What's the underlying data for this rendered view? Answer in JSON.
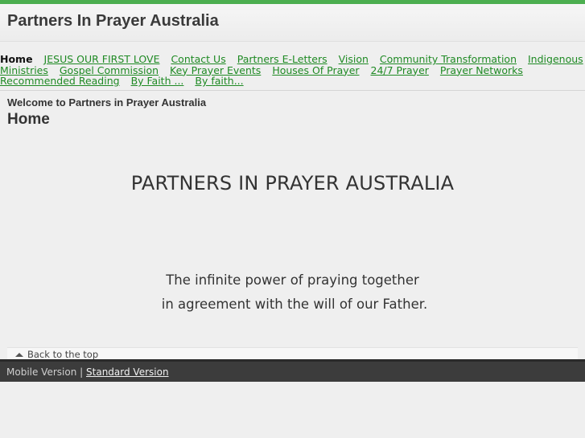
{
  "colors": {
    "accent": "#4caf50",
    "link": "#1f8a24",
    "footer_bg": "#3c3c3c"
  },
  "site": {
    "title": "Partners In Prayer Australia"
  },
  "nav": {
    "items": [
      {
        "label": "Home",
        "current": true
      },
      {
        "label": "JESUS OUR FIRST LOVE"
      },
      {
        "label": "Contact Us"
      },
      {
        "label": "Partners E-Letters"
      },
      {
        "label": "Vision"
      },
      {
        "label": "Community Transformation"
      },
      {
        "label": "Indigenous Ministries"
      },
      {
        "label": "Gospel Commission"
      },
      {
        "label": "Key Prayer Events"
      },
      {
        "label": "Houses Of Prayer"
      },
      {
        "label": "24/7 Prayer"
      },
      {
        "label": "Prayer Networks"
      },
      {
        "label": "Recommended Reading"
      },
      {
        "label": "By Faith ..."
      },
      {
        "label": "By faith..."
      }
    ]
  },
  "main": {
    "welcome": "Welcome to Partners in Prayer Australia",
    "page_title": "Home",
    "hero": "PARTNERS IN PRAYER AUSTRALIA",
    "tagline_line1": "The infinite power of praying together",
    "tagline_line2": "in agreement with the will of our Father.",
    "back_to_top": "Back to the top",
    "back_to_top_icon": "triangle-up-icon"
  },
  "footer": {
    "mobile_label": "Mobile Version",
    "separator": "|",
    "standard_label": "Standard Version"
  }
}
